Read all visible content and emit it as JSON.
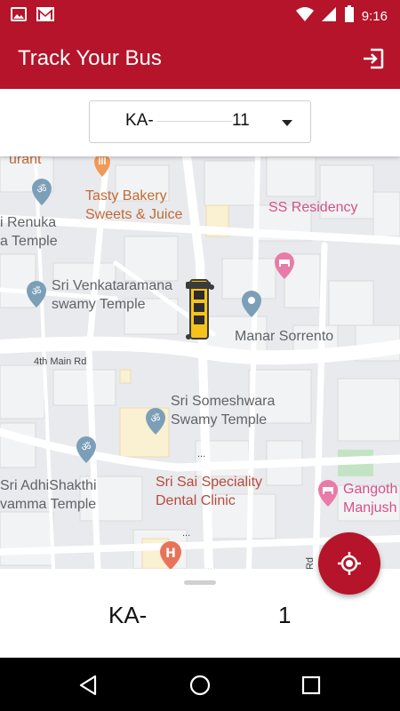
{
  "status_bar": {
    "time": "9:16",
    "icons": [
      "image-icon",
      "gmail-icon",
      "wifi-icon",
      "cell-signal-icon",
      "battery-icon"
    ]
  },
  "app_bar": {
    "title": "Track Your Bus",
    "action_icon": "exit-icon"
  },
  "bus_selector": {
    "value_prefix": "KA-",
    "value_suffix": "11"
  },
  "map": {
    "places": {
      "tasty_bakery_1": "Tasty Bakery",
      "tasty_bakery_2": "Sweets & Juice",
      "ss_residency": "SS Residency",
      "renuka_1": "i Renuka",
      "renuka_2": "a Temple",
      "venkataramana_1": "Sri Venkataramana",
      "venkataramana_2": "swamy Temple",
      "manar_sorrento": "Manar Sorrento",
      "fourth_main_rd": "4th Main Rd",
      "someshwara_1": "Sri Someshwara",
      "someshwara_2": "Swamy Temple",
      "adhishakthi_1": "Sri AdhiShakthi",
      "adhishakthi_2": "vamma Temple",
      "sai_dental_1": "Sri Sai Speciality",
      "sai_dental_2": "Dental Clinic",
      "gangoth_1": "Gangoth",
      "gangoth_2": "Manjush",
      "top_cut": "urant",
      "rd_label": "Rd",
      "dots_1": "...",
      "dots_2": "...",
      "dots_3": "..."
    }
  },
  "bottom_sheet": {
    "bus_prefix": "KA-",
    "bus_suffix": "1"
  },
  "colors": {
    "primary": "#b5142a",
    "map_background": "#e8eaed"
  }
}
